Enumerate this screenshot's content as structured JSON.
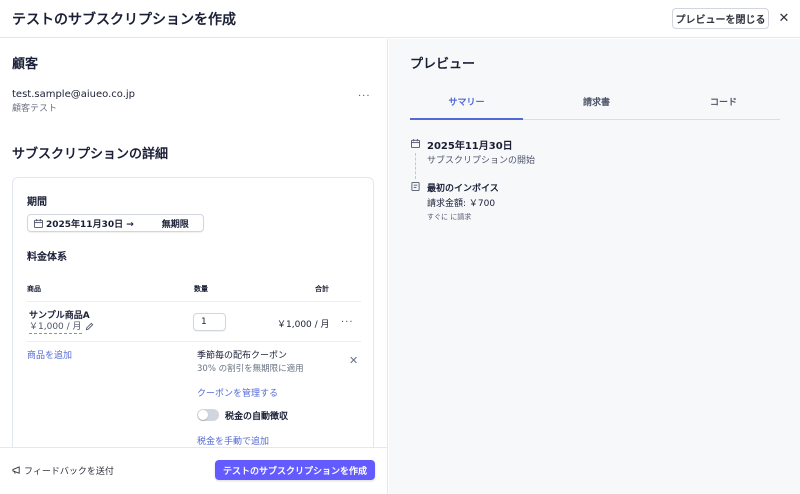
{
  "header": {
    "title": "テストのサブスクリプションを作成",
    "close_preview_label": "プレビューを閉じる",
    "close_symbol": "✕"
  },
  "customer": {
    "section_title": "顧客",
    "email": "test.sample@aiueo.co.jp",
    "name": "顧客テスト",
    "menu_symbol": "···"
  },
  "details": {
    "section_title": "サブスクリプションの詳細",
    "period_label": "期間",
    "period_start": "2025年11月30日 →",
    "period_end": "無期限",
    "pricing_label": "料金体系",
    "columns": {
      "product": "商品",
      "quantity": "数量",
      "total": "合計"
    },
    "item": {
      "name": "サンプル商品A",
      "price": "￥1,000 / 月",
      "quantity": "1",
      "total": "￥1,000 / 月",
      "menu_symbol": "···"
    },
    "add_product_label": "商品を追加",
    "coupon": {
      "name": "季節毎の配布クーポン",
      "description": "30% の割引を無期限に適用",
      "remove_symbol": "✕",
      "manage_label": "クーポンを管理する"
    },
    "auto_tax": {
      "label": "税金の自動徴収",
      "enabled": false
    },
    "manual_tax_label": "税金を手動で追加"
  },
  "footer": {
    "feedback_label": "フィードバックを送付",
    "create_label": "テストのサブスクリプションを作成"
  },
  "preview": {
    "title": "プレビュー",
    "tabs": [
      {
        "label": "サマリー",
        "active": true
      },
      {
        "label": "請求書",
        "active": false
      },
      {
        "label": "コード",
        "active": false
      }
    ],
    "timeline": {
      "date": "2025年11月30日",
      "start_label": "サブスクリプションの開始",
      "invoice_title": "最初のインボイス",
      "invoice_amount": "請求金額: ￥700",
      "invoice_when": "すぐに に請求"
    }
  },
  "colors": {
    "accent": "#635bff",
    "link": "#5469d4",
    "preview_bg": "#f6f8fa"
  },
  "icons": [
    "calendar-icon",
    "pencil-icon",
    "invoice-icon",
    "feedback-icon",
    "close-icon"
  ]
}
